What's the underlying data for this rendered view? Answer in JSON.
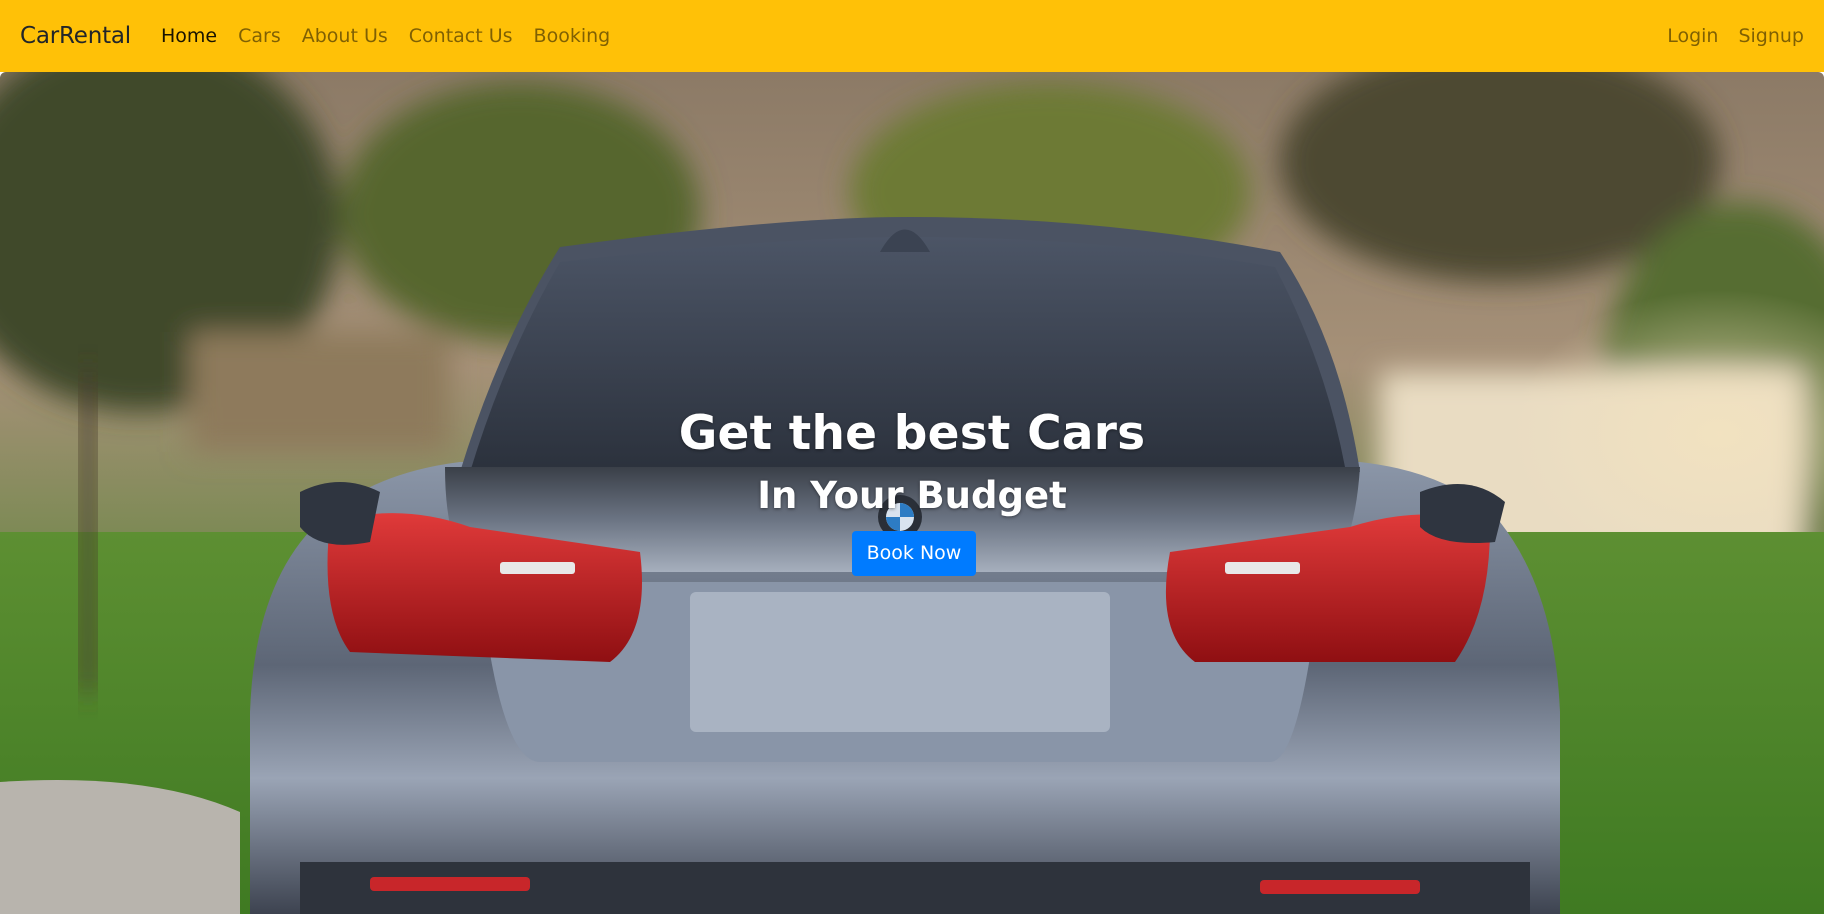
{
  "navbar": {
    "brand": "CarRental",
    "links": [
      {
        "label": "Home",
        "active": true
      },
      {
        "label": "Cars",
        "active": false
      },
      {
        "label": "About Us",
        "active": false
      },
      {
        "label": "Contact Us",
        "active": false
      },
      {
        "label": "Booking",
        "active": false
      }
    ],
    "right_links": [
      {
        "label": "Login"
      },
      {
        "label": "Signup"
      }
    ]
  },
  "hero": {
    "title": "Get the best Cars",
    "subtitle": "In Your Budget",
    "cta_label": "Book Now"
  },
  "colors": {
    "navbar_bg": "#ffc107",
    "button_primary": "#007bff",
    "hero_text": "#ffffff"
  }
}
